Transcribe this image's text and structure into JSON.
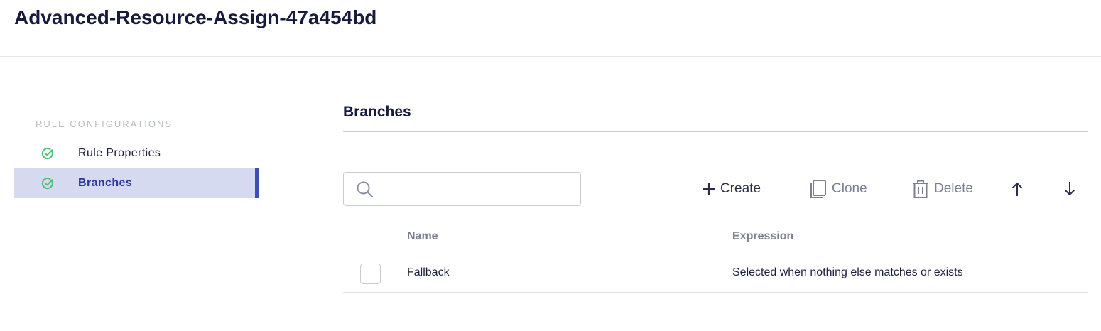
{
  "header": {
    "title": "Advanced-Resource-Assign-47a454bd"
  },
  "sidebar": {
    "heading": "RULE CONFIGURATIONS",
    "items": [
      {
        "label": "Rule Properties",
        "icon": "check-circle-icon",
        "status": "complete",
        "active": false
      },
      {
        "label": "Branches",
        "icon": "check-circle-icon",
        "status": "complete",
        "active": true
      }
    ]
  },
  "main": {
    "section_title": "Branches",
    "search": {
      "placeholder": "",
      "value": ""
    },
    "toolbar": {
      "create_label": "Create",
      "clone_label": "Clone",
      "delete_label": "Delete",
      "move_up_icon": "arrow-up-icon",
      "move_down_icon": "arrow-down-icon"
    },
    "table": {
      "columns": [
        "Name",
        "Expression"
      ],
      "rows": [
        {
          "name": "Fallback",
          "expression": "Selected when nothing else matches or exists",
          "checked": false
        }
      ]
    }
  },
  "colors": {
    "accent": "#3e4fb3",
    "active_bg": "#d6daf0",
    "check_green": "#4cc277",
    "title": "#161a3d"
  }
}
